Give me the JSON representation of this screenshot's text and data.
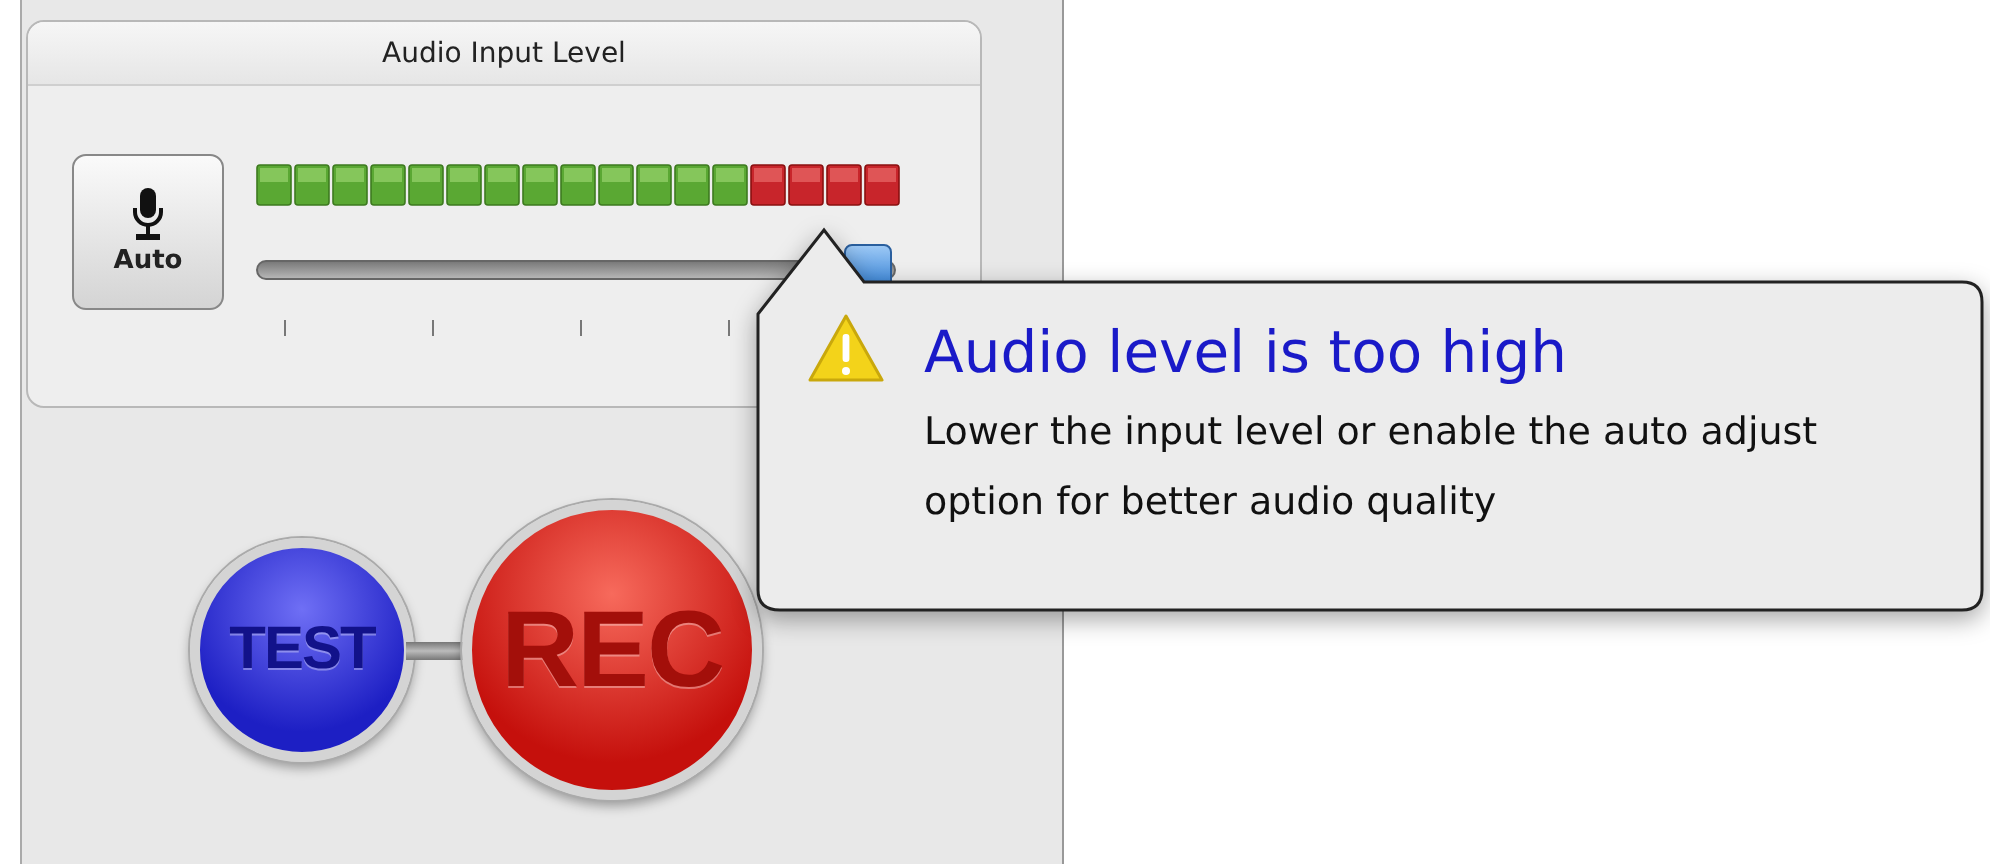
{
  "panel": {
    "title": "Audio Input Level"
  },
  "auto_button": {
    "label": "Auto"
  },
  "meter": {
    "level": 1
  },
  "slider": {
    "level": 0.96
  },
  "buttons": [
    {
      "label": "TEST",
      "kind": "test"
    },
    {
      "label": "REC",
      "kind": "record"
    }
  ],
  "tooltip": {
    "title": "Audio level is too high",
    "message": "Lower the input level or enable the auto adjust option for better audio quality"
  }
}
